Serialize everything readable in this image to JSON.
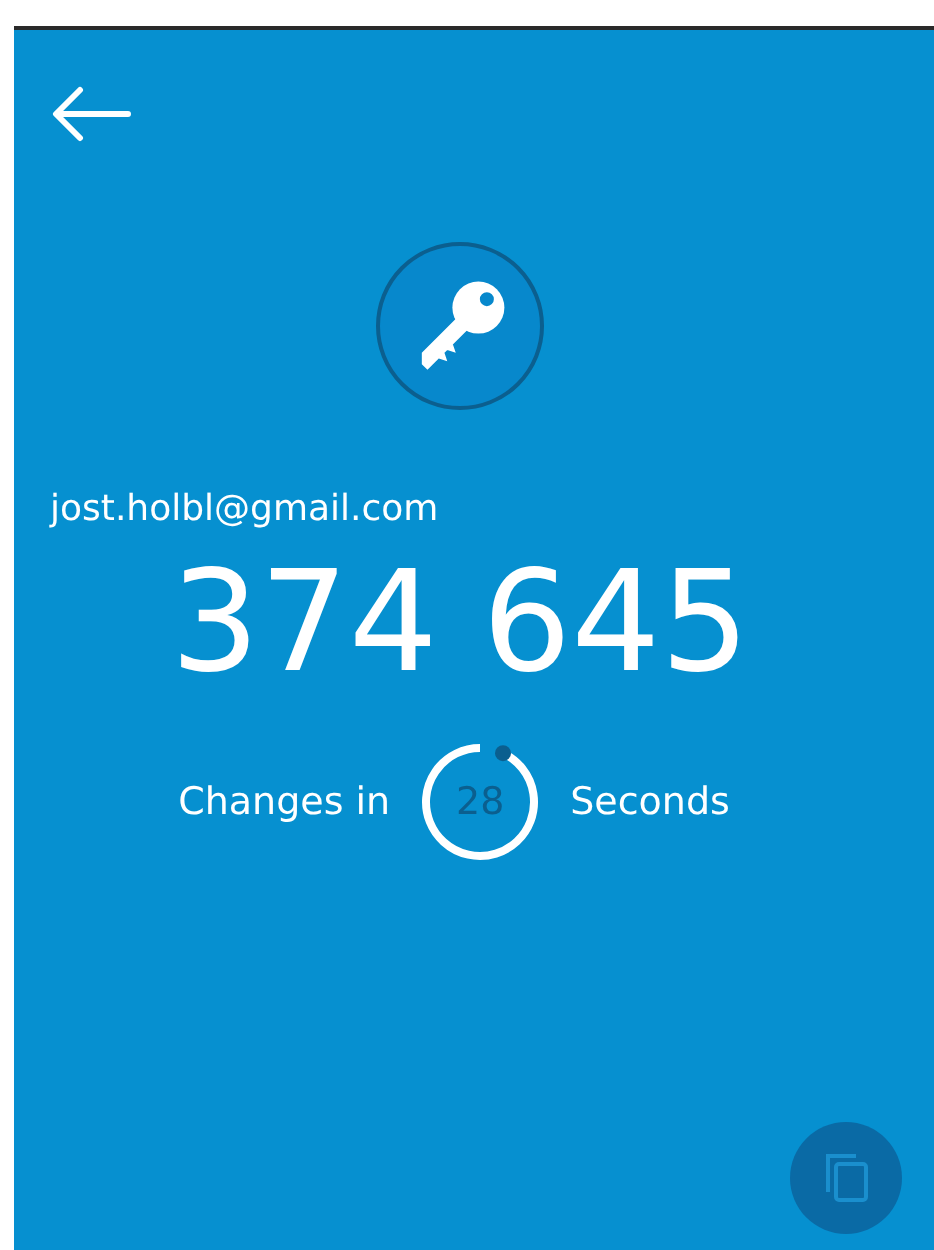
{
  "account": "jost.holbl@gmail.com",
  "code": "374 645",
  "countdown": {
    "prefix": "Changes in",
    "value": "28",
    "suffix": "Seconds"
  }
}
